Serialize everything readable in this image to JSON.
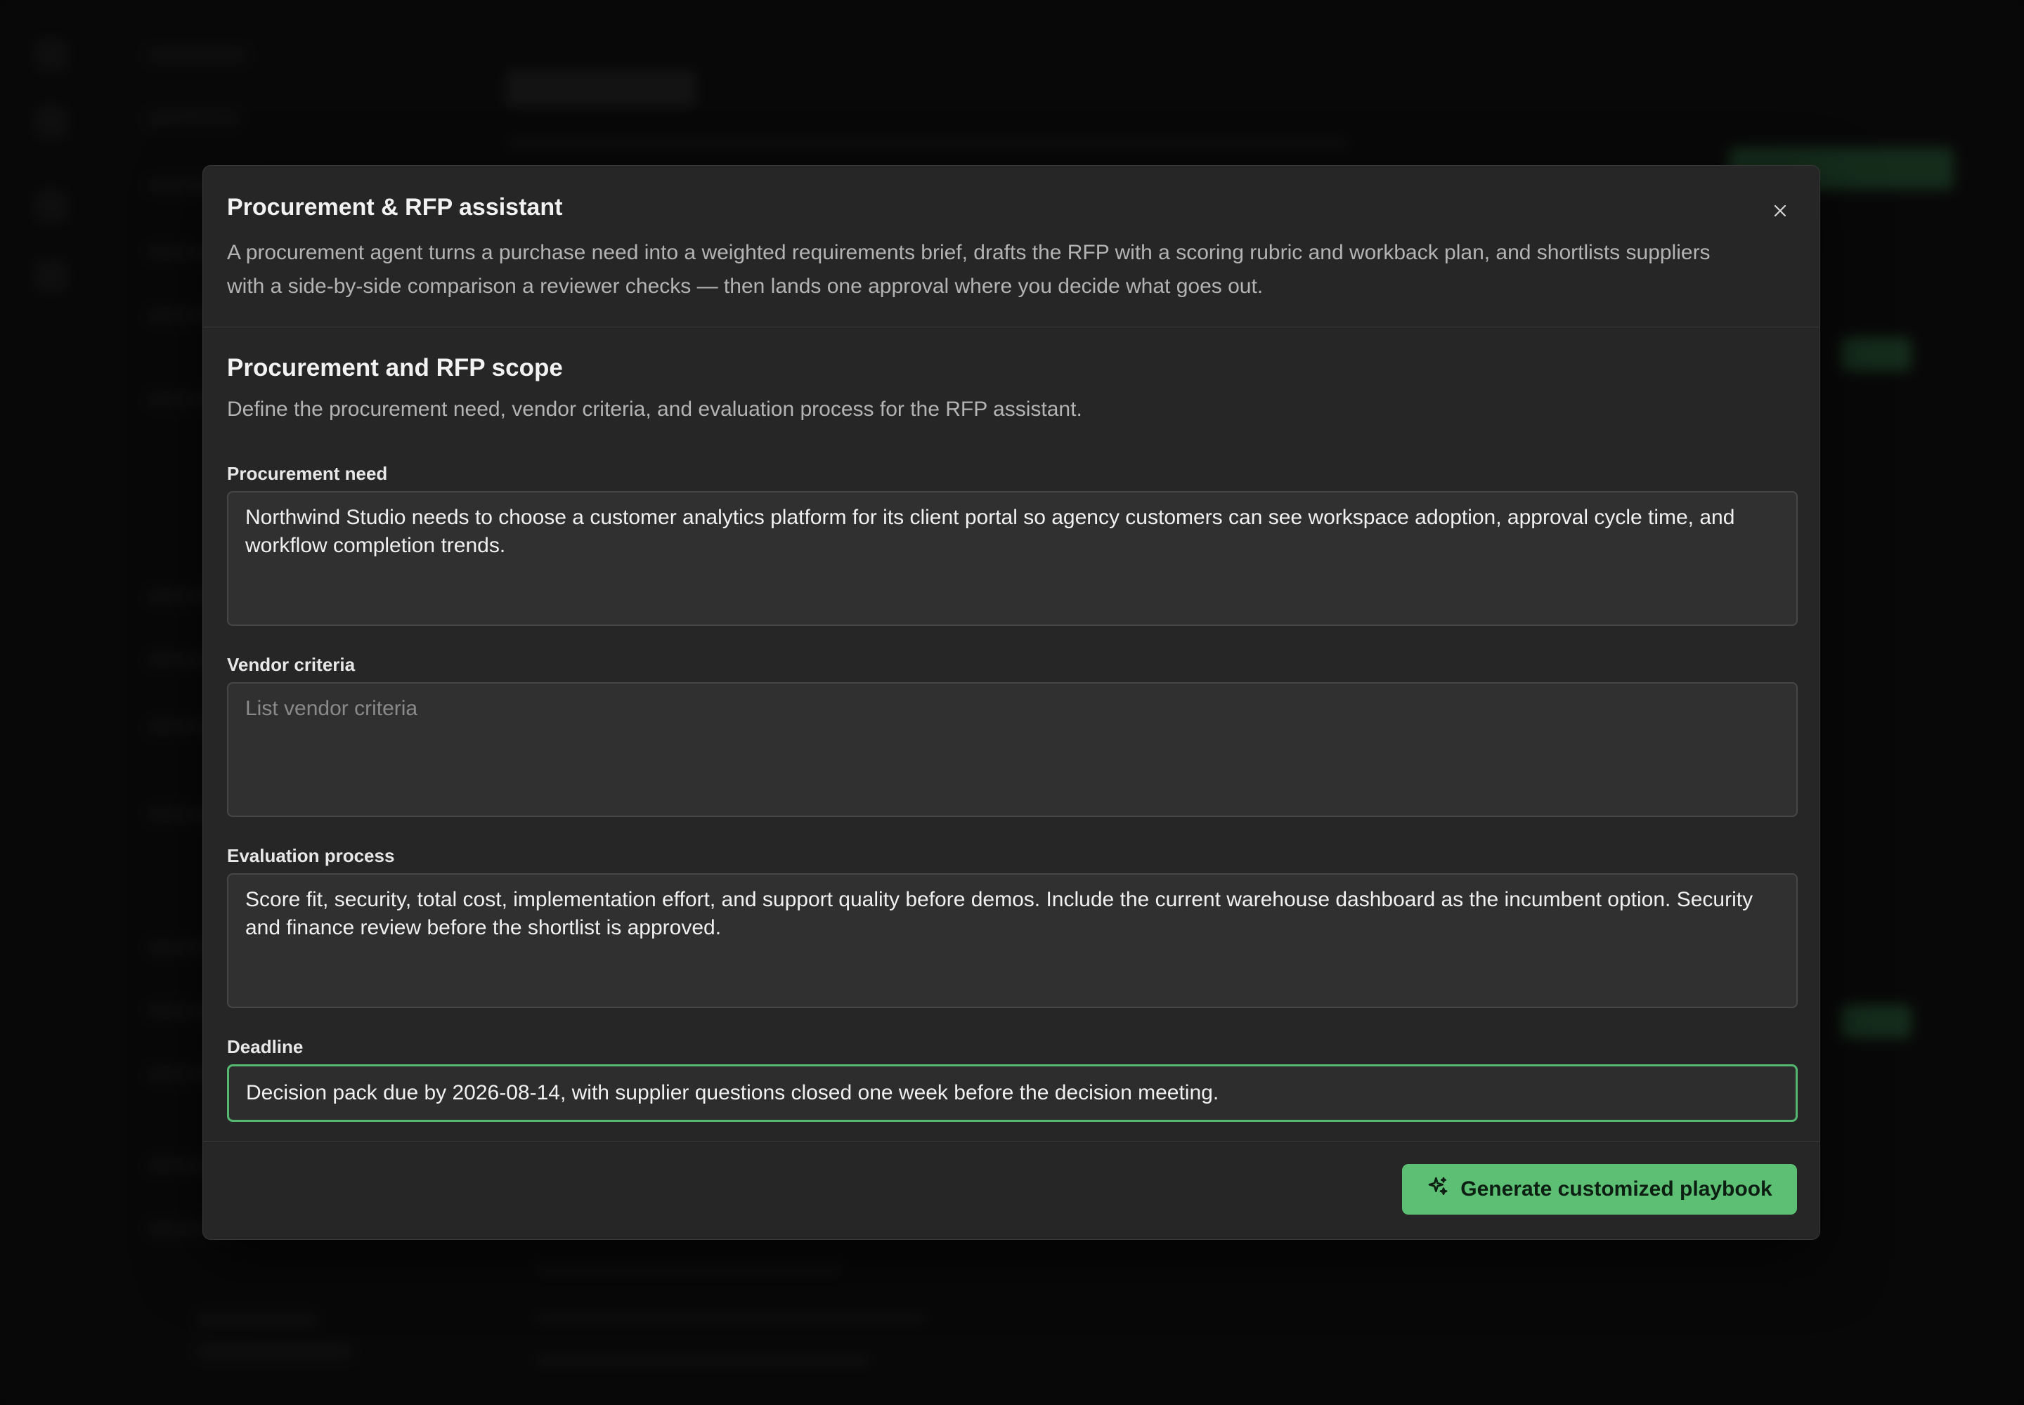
{
  "modal": {
    "title": "Procurement & RFP assistant",
    "description": "A procurement agent turns a purchase need into a weighted requirements brief, drafts the RFP with a scoring rubric and workback plan, and shortlists suppliers with a side-by-side comparison a reviewer checks — then lands one approval where you decide what goes out.",
    "close_icon": "close-icon"
  },
  "scope": {
    "title": "Procurement and RFP scope",
    "description": "Define the procurement need, vendor criteria, and evaluation process for the RFP assistant."
  },
  "fields": {
    "procurement_need": {
      "label": "Procurement need",
      "value": "Northwind Studio needs to choose a customer analytics platform for its client portal so agency customers can see workspace adoption, approval cycle time, and workflow completion trends."
    },
    "vendor_criteria": {
      "label": "Vendor criteria",
      "value": "",
      "placeholder": "List vendor criteria"
    },
    "evaluation_process": {
      "label": "Evaluation process",
      "value": "Score fit, security, total cost, implementation effort, and support quality before demos. Include the current warehouse dashboard as the incumbent option. Security and finance review before the shortlist is approved."
    },
    "deadline": {
      "label": "Deadline",
      "value": "Decision pack due by 2026-08-14, with supplier questions closed one week before the decision meeting."
    }
  },
  "footer": {
    "generate_label": "Generate customized playbook",
    "generate_icon": "sparkles-icon",
    "accent": "#5cbf74"
  }
}
